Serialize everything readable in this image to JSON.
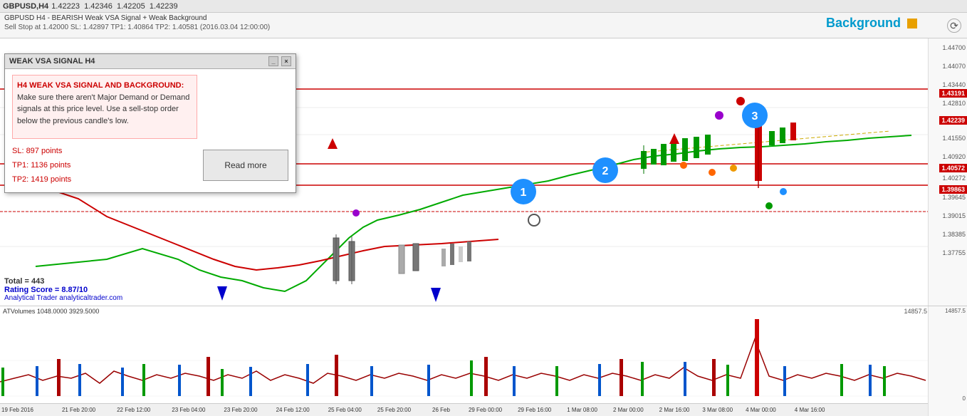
{
  "chart": {
    "symbol": "GBPUSD,H4",
    "prices": {
      "open": "1.42223",
      "high": "1.42346",
      "low": "1.42205",
      "close": "1.42239"
    },
    "title_info": "GBPUSD H4 - BEARISH Weak VSA Signal + Weak Background",
    "sell_stop": "Sell Stop at 1.42000  SL: 1.42897  TP1: 1.40864  TP2: 1.40581 (2016.03.04 12:00:00)",
    "bg_label": "Background",
    "price_levels": {
      "p1": {
        "value": "1.44700",
        "top_pct": 2
      },
      "p2": {
        "value": "1.44070",
        "top_pct": 9
      },
      "p3": {
        "value": "1.43440",
        "top_pct": 16
      },
      "p4": {
        "value": "1.43191",
        "top_pct": 19,
        "type": "red"
      },
      "p5": {
        "value": "1.42810",
        "top_pct": 23
      },
      "p6": {
        "value": "1.42239",
        "top_pct": 29,
        "type": "red"
      },
      "p7": {
        "value": "1.41550",
        "top_pct": 36
      },
      "p8": {
        "value": "1.40920",
        "top_pct": 43
      },
      "p9": {
        "value": "1.40572",
        "top_pct": 47,
        "type": "red"
      },
      "p10": {
        "value": "1.40272",
        "top_pct": 50
      },
      "p11": {
        "value": "1.39863",
        "top_pct": 55,
        "type": "red"
      },
      "p12": {
        "value": "1.39645",
        "top_pct": 57
      },
      "p13": {
        "value": "1.39015",
        "top_pct": 64
      },
      "p14": {
        "value": "1.38385",
        "top_pct": 71
      },
      "p15": {
        "value": "1.37755",
        "top_pct": 78
      }
    }
  },
  "popup": {
    "title": "WEAK VSA SIGNAL H4",
    "message": "H4 WEAK VSA SIGNAL AND BACKGROUND: Make sure there aren't Major Demand or Demand signals at this price level. Use a sell-stop order below the previous candle's low.",
    "sl": "SL: 897 points",
    "tp1": "TP1: 1136 points",
    "tp2": "TP2: 1419 points",
    "read_more": "Read more"
  },
  "bottom": {
    "total": "Total = 443",
    "rating": "Rating Score = 8.87/10",
    "attribution": "Analytical Trader  analyticaltrader.com"
  },
  "volume": {
    "label": "ATVolumes 1048.0000 3929.5000",
    "max_value": "14857.5"
  },
  "dates": [
    "19 Feb 2016",
    "21 Feb 20:00",
    "22 Feb 12:00",
    "23 Feb 04:00",
    "23 Feb 20:00",
    "24 Feb 12:00",
    "25 Feb 04:00",
    "25 Feb 20:00",
    "26 Feb",
    "29 Feb 00:00",
    "29 Feb 16:00",
    "1 Mar 08:00",
    "2 Mar 00:00",
    "2 Mar 16:00",
    "3 Mar 08:00",
    "4 Mar 00:00",
    "4 Mar 16:00"
  ]
}
